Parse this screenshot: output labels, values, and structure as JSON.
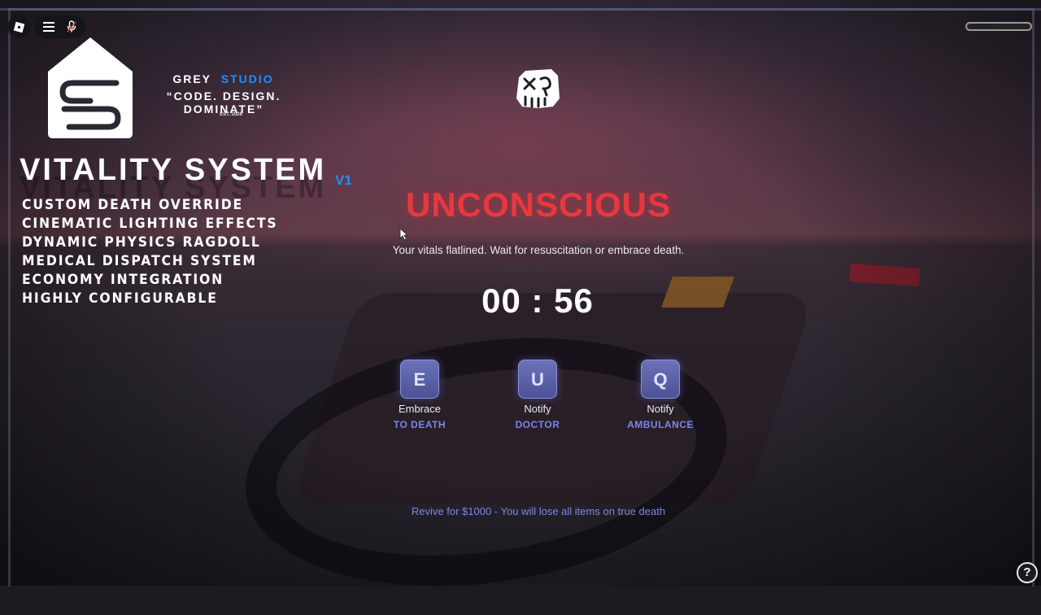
{
  "brand": {
    "name_part1": "GREY",
    "name_part2": "STUDIO",
    "tagline": "“CODE. DESIGN. DOMINATE”",
    "established": "EST. 2026",
    "monogram": "GS"
  },
  "product": {
    "title": "VITALITY SYSTEM",
    "version": "V1",
    "features": [
      "CUSTOM DEATH OVERRIDE",
      "CINEMATIC LIGHTING EFFECTS",
      "DYNAMIC PHYSICS RAGDOLL",
      "MEDICAL DISPATCH SYSTEM",
      "ECONOMY INTEGRATION",
      "HIGHLY CONFIGURABLE"
    ]
  },
  "death_screen": {
    "status": "UNCONSCIOUS",
    "message": "Your vitals flatlined. Wait for resuscitation or embrace death.",
    "timer": "00 : 56",
    "actions": [
      {
        "key": "E",
        "label": "Embrace",
        "target": "TO DEATH"
      },
      {
        "key": "U",
        "label": "Notify",
        "target": "DOCTOR"
      },
      {
        "key": "Q",
        "label": "Notify",
        "target": "AMBULANCE"
      }
    ],
    "revive_note": "Revive for $1000 - You will lose all items on true death"
  },
  "icons": {
    "roblox_menu": "roblox-logo-icon",
    "menu": "hamburger-menu-icon",
    "voice": "microphone-muted-icon",
    "status": "skull-icon",
    "help": "help-icon",
    "help_glyph": "?"
  },
  "colors": {
    "accent_blue": "#1e90ff",
    "status_red": "#e8383e",
    "key_purple": "#5a5fa8",
    "action_text": "#7c86e8"
  }
}
